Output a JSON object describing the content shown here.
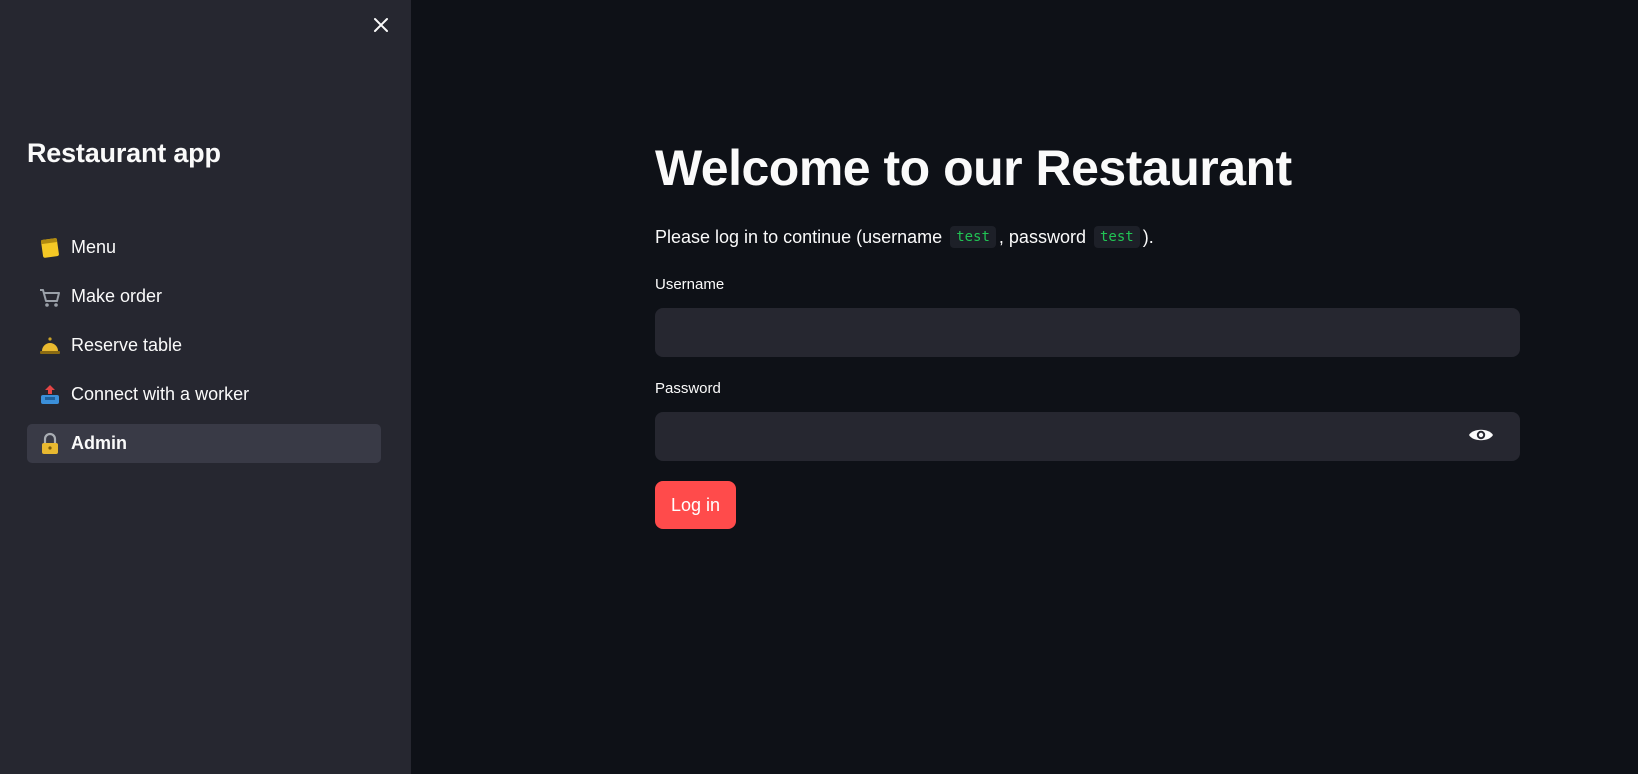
{
  "sidebar": {
    "title": "Restaurant app",
    "close_icon": "close-icon",
    "items": [
      {
        "label": "Menu",
        "icon": "notepad-icon",
        "active": false
      },
      {
        "label": "Make order",
        "icon": "shopping-cart-icon",
        "active": false
      },
      {
        "label": "Reserve table",
        "icon": "bellhop-bell-icon",
        "active": false
      },
      {
        "label": "Connect with a worker",
        "icon": "outbox-tray-icon",
        "active": false
      },
      {
        "label": "Admin",
        "icon": "lock-icon",
        "active": true
      }
    ]
  },
  "main": {
    "heading": "Welcome to our Restaurant",
    "intro": {
      "part1": "Please log in to continue (username",
      "username_code": "test",
      "part2": ", password",
      "password_code": "test",
      "part3": ")."
    },
    "username": {
      "label": "Username",
      "value": "",
      "placeholder": ""
    },
    "password": {
      "label": "Password",
      "value": "",
      "placeholder": "",
      "toggle_icon": "eye-icon"
    },
    "login_button": "Log in"
  },
  "colors": {
    "sidebar_bg": "#262730",
    "main_bg": "#0e1117",
    "input_bg": "#262730",
    "active_item_bg": "#393a46",
    "primary_button": "#ff4b4b",
    "code_text": "#21c354"
  }
}
